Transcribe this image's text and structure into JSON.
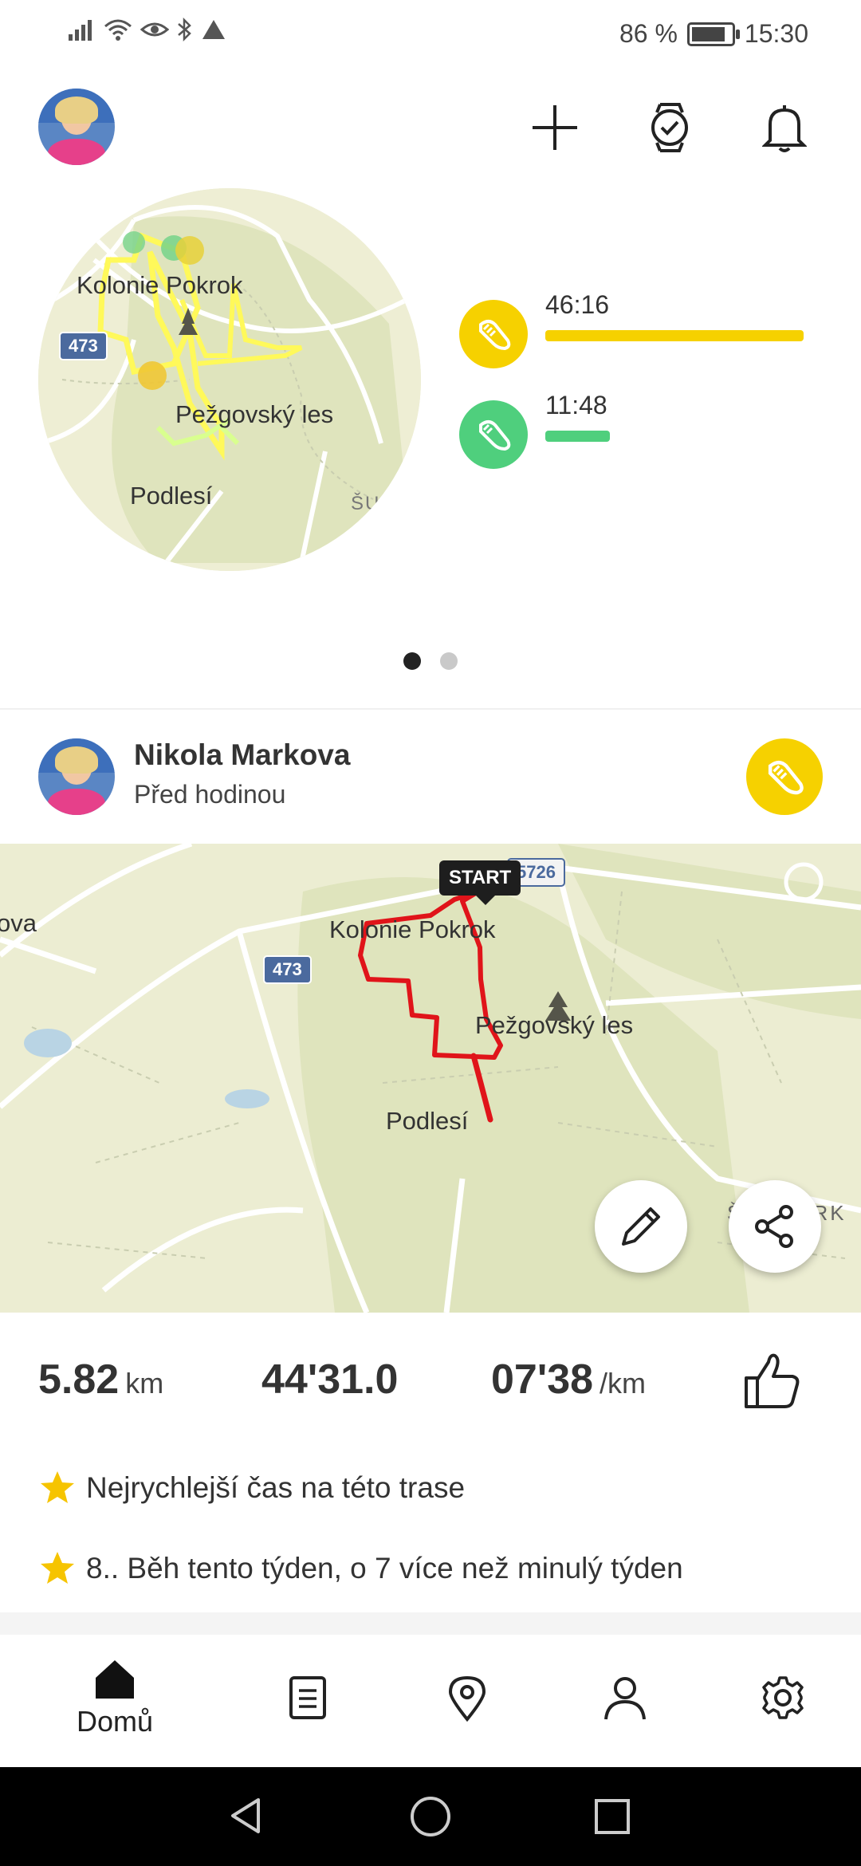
{
  "status_bar": {
    "battery_text": "86 %",
    "battery_level": 0.86,
    "time": "15:30"
  },
  "summary": {
    "map": {
      "labels": [
        "Kolonie Pokrok",
        "Pežgovský les",
        "Podlesí",
        "ŠU"
      ],
      "road_number": "473"
    },
    "activities": [
      {
        "time": "46:16",
        "color": "#f6d100",
        "bar_fraction": 1.0,
        "icon": "running-shoe-icon"
      },
      {
        "time": "11:48",
        "color": "#4fcf7d",
        "bar_fraction": 0.25,
        "icon": "walking-shoe-icon"
      }
    ],
    "page_count": 2,
    "active_page": 1
  },
  "feed": {
    "user_name": "Nikola Markova",
    "time_ago": "Před hodinou",
    "map": {
      "start_label": "START",
      "labels": [
        "Kolonie Pokrok",
        "Pežgovský les",
        "Podlesí",
        "ŠUMBARK",
        "ova"
      ],
      "road_numbers": [
        "473",
        "5726"
      ]
    },
    "distance": {
      "value": "5.82",
      "unit": "km"
    },
    "duration": {
      "value": "44'31.0"
    },
    "pace": {
      "value": "07'38",
      "unit": "/km"
    },
    "achievements": [
      "Nejrychlejší čas na této trase",
      "8.. Běh tento týden, o 7 více než minulý týden"
    ]
  },
  "bottom_nav": {
    "items": [
      {
        "label": "Domů",
        "icon": "home-icon",
        "active": true
      },
      {
        "label": "",
        "icon": "diary-icon"
      },
      {
        "label": "",
        "icon": "map-pin-icon"
      },
      {
        "label": "",
        "icon": "profile-icon"
      },
      {
        "label": "",
        "icon": "settings-gear-icon"
      }
    ]
  },
  "colors": {
    "accent_yellow": "#f6d100",
    "accent_green": "#4fcf7d",
    "route_red": "#e0141a",
    "map_bg": "#ecedd2"
  }
}
